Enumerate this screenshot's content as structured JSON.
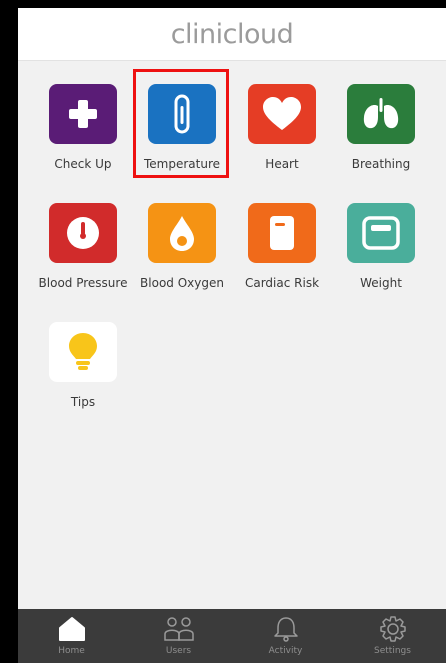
{
  "header": {
    "logo_text": "clinicloud"
  },
  "tiles": [
    {
      "label": "Check Up",
      "icon": "plus-icon",
      "color": "#5a1c76"
    },
    {
      "label": "Temperature",
      "icon": "thermometer-icon",
      "color": "#1a72c1"
    },
    {
      "label": "Heart",
      "icon": "heart-icon",
      "color": "#e53d25"
    },
    {
      "label": "Breathing",
      "icon": "lungs-icon",
      "color": "#2b7d3c"
    },
    {
      "label": "Blood Pressure",
      "icon": "gauge-icon",
      "color": "#d12b2b"
    },
    {
      "label": "Blood Oxygen",
      "icon": "oxygen-drop-icon",
      "color": "#f59314"
    },
    {
      "label": "Cardiac Risk",
      "icon": "document-icon",
      "color": "#f06a1a"
    },
    {
      "label": "Weight",
      "icon": "scale-icon",
      "color": "#4aae9b"
    },
    {
      "label": "Tips",
      "icon": "lightbulb-icon",
      "color": "#ffffff"
    }
  ],
  "selected_tile": "Temperature",
  "highlight_color": "#ee1111",
  "tabbar": {
    "tabs": [
      {
        "label": "Home",
        "icon": "home-icon"
      },
      {
        "label": "Users",
        "icon": "users-icon"
      },
      {
        "label": "Activity",
        "icon": "bell-icon"
      },
      {
        "label": "Settings",
        "icon": "gear-icon"
      }
    ],
    "background": "#3b3b3b"
  }
}
